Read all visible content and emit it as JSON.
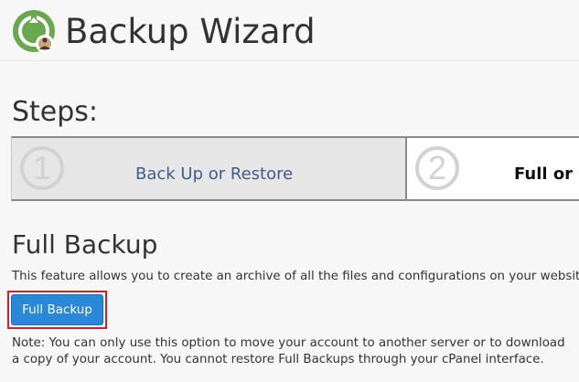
{
  "header": {
    "title": "Backup Wizard",
    "icon": "backup-wizard-icon"
  },
  "steps": {
    "heading": "Steps:",
    "items": [
      {
        "number": "1",
        "label": "Back Up or Restore",
        "state": "completed"
      },
      {
        "number": "2",
        "label": "Full or P",
        "state": "current"
      }
    ]
  },
  "section": {
    "heading": "Full Backup",
    "description": "This feature allows you to create an archive of all the files and configurations on your website.",
    "button_label": "Full Backup",
    "note": "Note: You can only use this option to move your account to another server or to download a copy of your account. You cannot restore Full Backups through your cPanel interface."
  },
  "colors": {
    "accent": "#2a88d8",
    "highlight": "#d0202e",
    "step_label": "#3f5d8a",
    "icon_green": "#6aa84f"
  }
}
